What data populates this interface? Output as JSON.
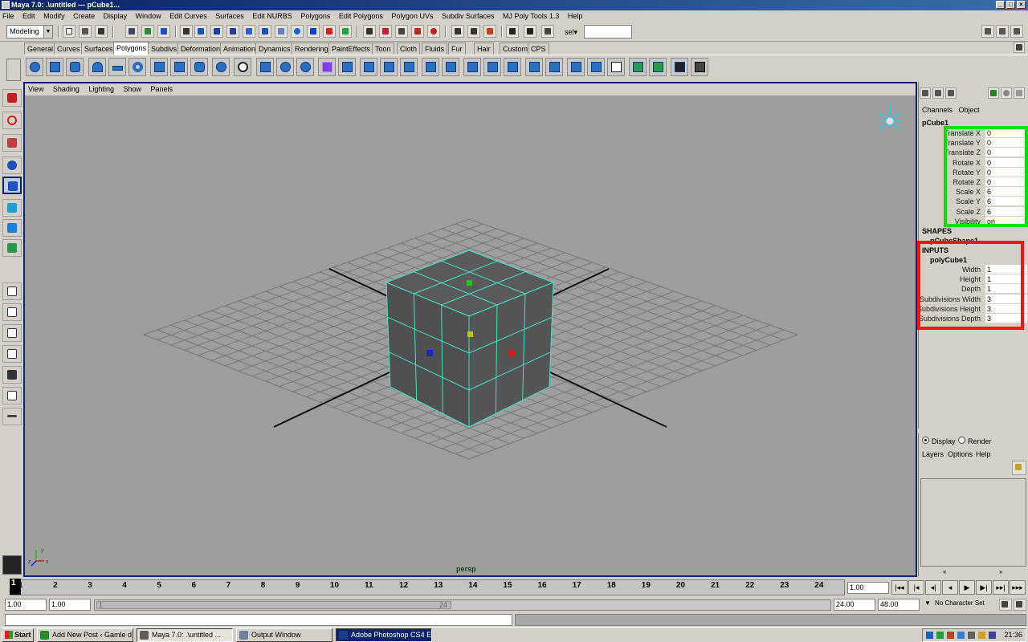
{
  "window": {
    "title": "Maya 7.0: .\\untitled   ---   pCube1...",
    "min": "_",
    "max": "□",
    "close": "×"
  },
  "menubar": [
    "File",
    "Edit",
    "Modify",
    "Create",
    "Display",
    "Window",
    "Edit Curves",
    "Surfaces",
    "Edit NURBS",
    "Polygons",
    "Edit Polygons",
    "Polygon UVs",
    "Subdiv Surfaces",
    "MJ Poly Tools 1.3",
    "Help"
  ],
  "statusline": {
    "mode": "Modeling",
    "sel_label": "sel▾",
    "sel_value": ""
  },
  "shelf_tabs": [
    "General",
    "Curves",
    "Surfaces",
    "Polygons",
    "Subdivs",
    "Deformation",
    "Animation",
    "Dynamics",
    "Rendering",
    "PaintEffects",
    "Toon",
    "Cloth",
    "Fluids",
    "Fur",
    "Hair",
    "Custom",
    "CPS"
  ],
  "shelf_active": "Polygons",
  "panel_menu": [
    "View",
    "Shading",
    "Lighting",
    "Show",
    "Panels"
  ],
  "viewport": {
    "camera": "persp",
    "axis_x": "x",
    "axis_y": "y",
    "axis_z": "z"
  },
  "channelbox": {
    "tabs": [
      "Channels",
      "Object"
    ],
    "object": "pCube1",
    "attributes": [
      {
        "label": "Translate X",
        "value": "0"
      },
      {
        "label": "Translate Y",
        "value": "0"
      },
      {
        "label": "Translate Z",
        "value": "0"
      },
      {
        "label": "Rotate X",
        "value": "0"
      },
      {
        "label": "Rotate Y",
        "value": "0"
      },
      {
        "label": "Rotate Z",
        "value": "0"
      },
      {
        "label": "Scale X",
        "value": "6"
      },
      {
        "label": "Scale Y",
        "value": "6"
      },
      {
        "label": "Scale Z",
        "value": "6"
      },
      {
        "label": "Visibility",
        "value": "on"
      }
    ],
    "shapes_header": "SHAPES",
    "shape_name": "pCubeShape1",
    "inputs_header": "INPUTS",
    "input_node": "polyCube1",
    "inputs": [
      {
        "label": "Width",
        "value": "1"
      },
      {
        "label": "Height",
        "value": "1"
      },
      {
        "label": "Depth",
        "value": "1"
      },
      {
        "label": "Subdivisions Width",
        "value": "3"
      },
      {
        "label": "Subdivisions Height",
        "value": "3"
      },
      {
        "label": "Subdivisions Depth",
        "value": "3"
      }
    ]
  },
  "layers": {
    "display": "Display",
    "render": "Render",
    "menu": [
      "Layers",
      "Options",
      "Help"
    ],
    "scroll_left": "«",
    "scroll_right": "»"
  },
  "timeline": {
    "ticks": [
      "1",
      "2",
      "3",
      "4",
      "5",
      "6",
      "7",
      "8",
      "9",
      "10",
      "11",
      "12",
      "13",
      "14",
      "15",
      "16",
      "17",
      "18",
      "19",
      "20",
      "21",
      "22",
      "23",
      "24"
    ],
    "current": "1",
    "current_field": "1.00",
    "playback": [
      "|◂◂",
      "|◂",
      "◂|",
      "◂",
      "▶",
      "▶|",
      "▸▸|",
      "▸▸▸"
    ]
  },
  "range": {
    "start": "1.00",
    "playstart": "1.00",
    "slider_start": "1",
    "slider_end": "24",
    "playend": "24.00",
    "end": "48.00",
    "char_set": "No Character Set"
  },
  "taskbar": {
    "start": "Start",
    "items": [
      {
        "label": "Add New Post ‹ Gamle d...",
        "state": "normal",
        "color": "#2a8a2a"
      },
      {
        "label": "Maya 7.0: .\\untitled  ...",
        "state": "pressed",
        "color": "#606060"
      },
      {
        "label": "Output Window",
        "state": "normal",
        "color": "#7080a0"
      },
      {
        "label": "Adobe Photoshop CS4 E...",
        "state": "active",
        "color": "#1c3c8c"
      }
    ],
    "clock": "21:36"
  },
  "colors": {
    "viewport_bg": "#9e9e9e",
    "cube_face": "#5a5a5a",
    "wire": "#40e0c8",
    "highlight_green": "#00e000",
    "highlight_red": "#ff1010"
  }
}
